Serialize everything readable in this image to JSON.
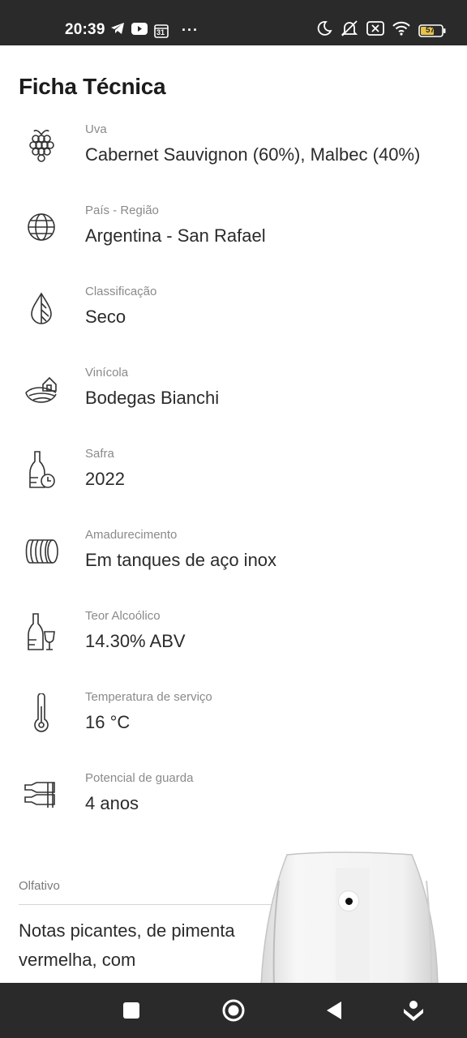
{
  "status_bar": {
    "time": "20:39",
    "calendar_day": "31",
    "battery_level": "57",
    "left_icons": [
      "telegram-icon",
      "youtube-icon",
      "calendar-icon",
      "more-dots"
    ],
    "right_icons": [
      "moon-icon",
      "mute-icon",
      "sim-off-icon",
      "wifi-icon",
      "battery-icon"
    ]
  },
  "page": {
    "title": "Ficha Técnica"
  },
  "specs": [
    {
      "icon": "grape-icon",
      "label": "Uva",
      "value": "Cabernet Sauvignon (60%), Malbec (40%)"
    },
    {
      "icon": "globe-icon",
      "label": "País - Região",
      "value": "Argentina - San Rafael"
    },
    {
      "icon": "drop-icon",
      "label": "Classificação",
      "value": "Seco"
    },
    {
      "icon": "winery-icon",
      "label": "Vinícola",
      "value": "Bodegas Bianchi"
    },
    {
      "icon": "bottle-clock-icon",
      "label": "Safra",
      "value": "2022"
    },
    {
      "icon": "barrel-icon",
      "label": "Amadurecimento",
      "value": "Em tanques de aço inox"
    },
    {
      "icon": "bottle-glass-icon",
      "label": "Teor Alcoólico",
      "value": "14.30% ABV"
    },
    {
      "icon": "thermometer-icon",
      "label": "Temperatura de serviço",
      "value": "16 °C"
    },
    {
      "icon": "bottles-rack-icon",
      "label": "Potencial de guarda",
      "value": "4 anos"
    }
  ],
  "olfativo": {
    "label": "Olfativo",
    "text": "Notas picantes, de pimenta vermelha, com"
  },
  "nav_bar": {
    "buttons": [
      "recents-button",
      "home-button",
      "back-button",
      "assist-button"
    ]
  },
  "colors": {
    "status_bar_bg": "#2a2a2a",
    "text_primary": "#2b2b2b",
    "text_secondary": "#8a8a8a",
    "battery": "#e8c24a"
  }
}
